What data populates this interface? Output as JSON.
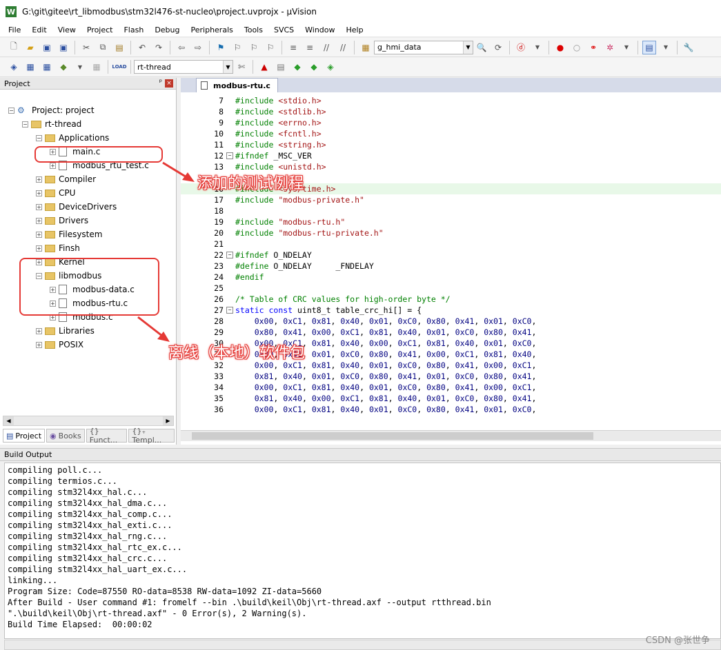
{
  "window": {
    "title": "G:\\git\\gitee\\rt_libmodbus\\stm32l476-st-nucleo\\project.uvprojx - μVision",
    "app_icon": "W"
  },
  "menu": [
    "File",
    "Edit",
    "View",
    "Project",
    "Flash",
    "Debug",
    "Peripherals",
    "Tools",
    "SVCS",
    "Window",
    "Help"
  ],
  "toolbar": {
    "find_value": "g_hmi_data",
    "target_value": "rt-thread",
    "load_label": "LOAD"
  },
  "project_panel": {
    "title": "Project",
    "pin": "ᵖ",
    "close": "×",
    "root": "Project: project",
    "group": "rt-thread",
    "items": [
      {
        "label": "Applications",
        "type": "folder",
        "expanded": true
      },
      {
        "label": "main.c",
        "type": "file"
      },
      {
        "label": "modbus_rtu_test.c",
        "type": "file"
      },
      {
        "label": "Compiler",
        "type": "folder"
      },
      {
        "label": "CPU",
        "type": "folder"
      },
      {
        "label": "DeviceDrivers",
        "type": "folder"
      },
      {
        "label": "Drivers",
        "type": "folder"
      },
      {
        "label": "Filesystem",
        "type": "folder"
      },
      {
        "label": "Finsh",
        "type": "folder"
      },
      {
        "label": "Kernel",
        "type": "folder"
      },
      {
        "label": "libmodbus",
        "type": "folder",
        "expanded": true
      },
      {
        "label": "modbus-data.c",
        "type": "file"
      },
      {
        "label": "modbus-rtu.c",
        "type": "file"
      },
      {
        "label": "modbus.c",
        "type": "file"
      },
      {
        "label": "Libraries",
        "type": "folder"
      },
      {
        "label": "POSIX",
        "type": "folder"
      }
    ],
    "tabs": [
      "Project",
      "Books",
      "{} Funct...",
      "{}₊ Templ..."
    ]
  },
  "editor": {
    "tab": "modbus-rtu.c",
    "lines": [
      {
        "n": "7",
        "t": "#include <stdio.h>"
      },
      {
        "n": "8",
        "t": "#include <stdlib.h>"
      },
      {
        "n": "9",
        "t": "#include <errno.h>"
      },
      {
        "n": "10",
        "t": "#include <fcntl.h>"
      },
      {
        "n": "11",
        "t": "#include <string.h>"
      },
      {
        "n": "12",
        "t": "#ifndef _MSC_VER"
      },
      {
        "n": "13",
        "t": "#include <unistd.h>"
      },
      {
        "n": "",
        "t": ""
      },
      {
        "n": "16",
        "t": "#include <sys/time.h>"
      },
      {
        "n": "17",
        "t": "#include \"modbus-private.h\""
      },
      {
        "n": "18",
        "t": ""
      },
      {
        "n": "19",
        "t": "#include \"modbus-rtu.h\""
      },
      {
        "n": "20",
        "t": "#include \"modbus-rtu-private.h\""
      },
      {
        "n": "21",
        "t": ""
      },
      {
        "n": "22",
        "t": "#ifndef O_NDELAY"
      },
      {
        "n": "23",
        "t": "#define O_NDELAY     _FNDELAY"
      },
      {
        "n": "24",
        "t": "#endif"
      },
      {
        "n": "25",
        "t": ""
      },
      {
        "n": "26",
        "t": "/* Table of CRC values for high-order byte */"
      },
      {
        "n": "27",
        "t": "static const uint8_t table_crc_hi[] = {"
      },
      {
        "n": "28",
        "t": "    0x00, 0xC1, 0x81, 0x40, 0x01, 0xC0, 0x80, 0x41, 0x01, 0xC0,"
      },
      {
        "n": "29",
        "t": "    0x80, 0x41, 0x00, 0xC1, 0x81, 0x40, 0x01, 0xC0, 0x80, 0x41,"
      },
      {
        "n": "30",
        "t": "    0x00, 0xC1, 0x81, 0x40, 0x00, 0xC1, 0x81, 0x40, 0x01, 0xC0,"
      },
      {
        "n": "31",
        "t": "    0x80, 0x41, 0x01, 0xC0, 0x80, 0x41, 0x00, 0xC1, 0x81, 0x40,"
      },
      {
        "n": "32",
        "t": "    0x00, 0xC1, 0x81, 0x40, 0x01, 0xC0, 0x80, 0x41, 0x00, 0xC1,"
      },
      {
        "n": "33",
        "t": "    0x81, 0x40, 0x01, 0xC0, 0x80, 0x41, 0x01, 0xC0, 0x80, 0x41,"
      },
      {
        "n": "34",
        "t": "    0x00, 0xC1, 0x81, 0x40, 0x01, 0xC0, 0x80, 0x41, 0x00, 0xC1,"
      },
      {
        "n": "35",
        "t": "    0x81, 0x40, 0x00, 0xC1, 0x81, 0x40, 0x01, 0xC0, 0x80, 0x41,"
      },
      {
        "n": "36",
        "t": "    0x00, 0xC1, 0x81, 0x40, 0x01, 0xC0, 0x80, 0x41, 0x01, 0xC0,"
      }
    ]
  },
  "build_output": {
    "title": "Build Output",
    "lines": [
      "compiling poll.c...",
      "compiling termios.c...",
      "compiling stm32l4xx_hal.c...",
      "compiling stm32l4xx_hal_dma.c...",
      "compiling stm32l4xx_hal_comp.c...",
      "compiling stm32l4xx_hal_exti.c...",
      "compiling stm32l4xx_hal_rng.c...",
      "compiling stm32l4xx_hal_rtc_ex.c...",
      "compiling stm32l4xx_hal_crc.c...",
      "compiling stm32l4xx_hal_uart_ex.c...",
      "linking...",
      "Program Size: Code=87550 RO-data=8538 RW-data=1092 ZI-data=5660",
      "After Build - User command #1: fromelf --bin .\\build\\keil\\Obj\\rt-thread.axf --output rtthread.bin",
      "\".\\build\\keil\\Obj\\rt-thread.axf\" - 0 Error(s), 2 Warning(s).",
      "Build Time Elapsed:  00:00:02"
    ]
  },
  "annotations": {
    "test_example": "添加的测试例程",
    "offline_package": "离线（本地）软件包"
  },
  "watermark": "CSDN @张世争",
  "colors": {
    "annotation": "#e53935",
    "preprocessor": "#008000",
    "keyword": "#0000ff",
    "string": "#a31515"
  }
}
